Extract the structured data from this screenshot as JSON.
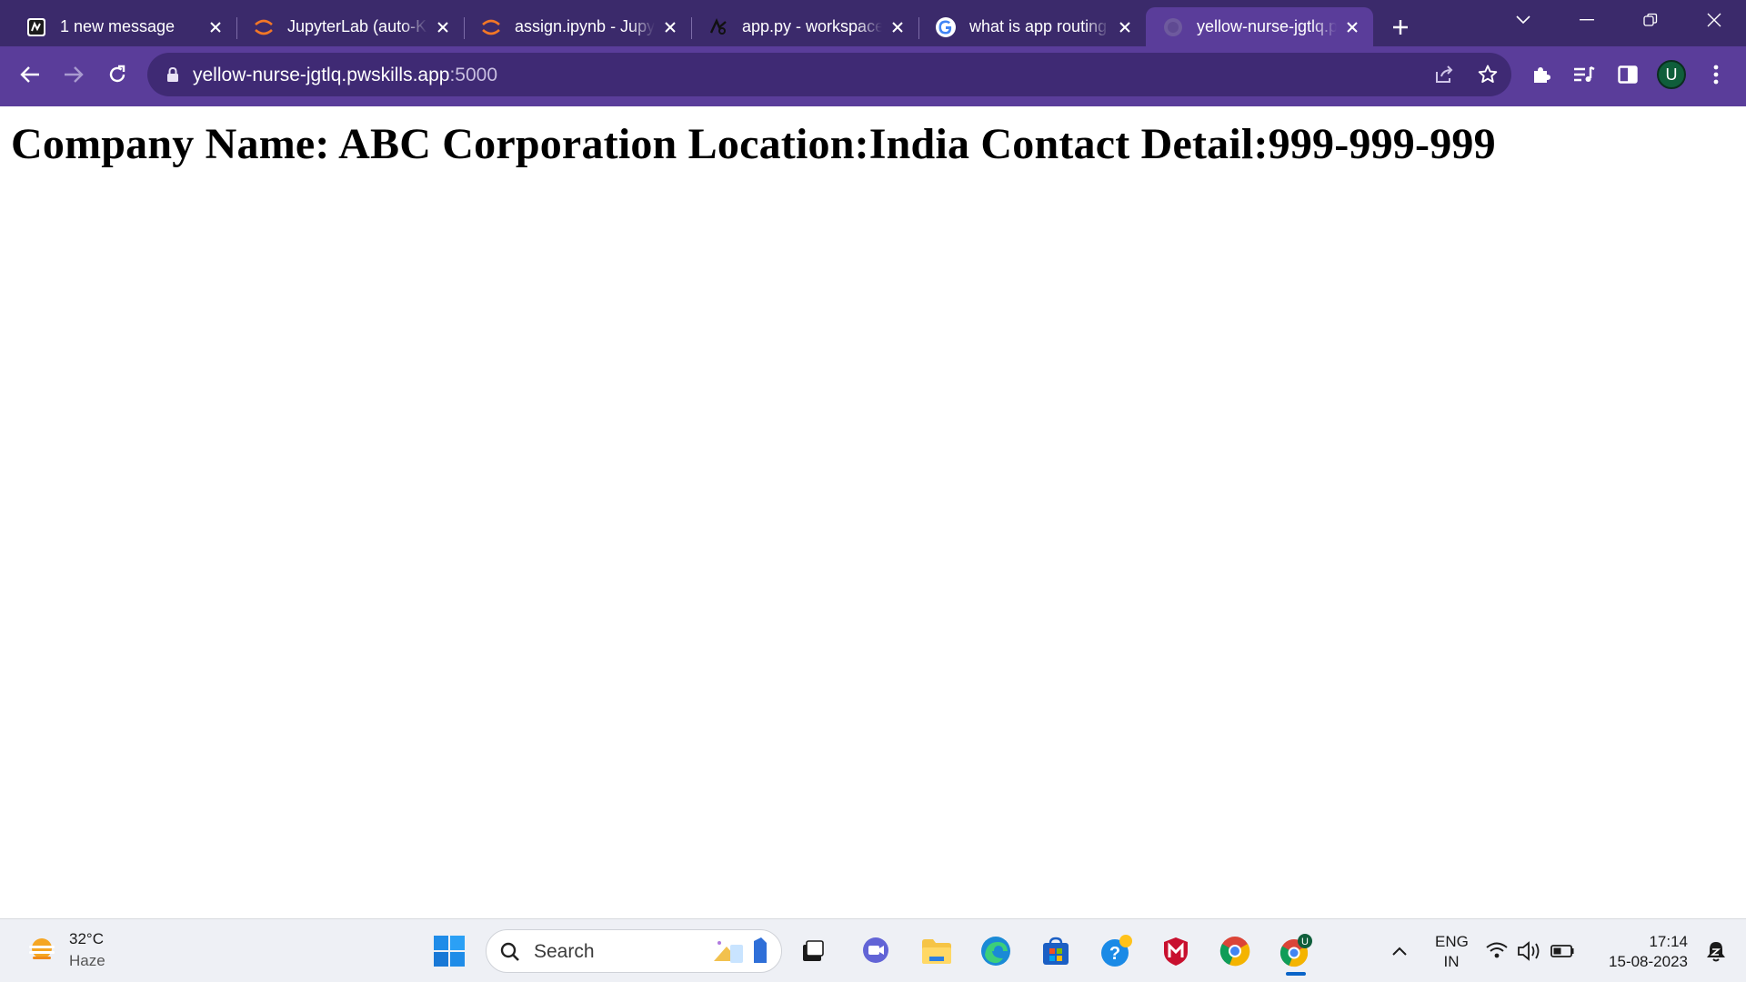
{
  "browser": {
    "tabs": [
      {
        "title": "1 new message",
        "favicon": "pw-skills-icon",
        "active": false
      },
      {
        "title": "JupyterLab (auto-K)",
        "favicon": "jupyter-icon",
        "active": false
      },
      {
        "title": "assign.ipynb - JupyterLab",
        "favicon": "jupyter-icon",
        "active": false
      },
      {
        "title": "app.py - workspace",
        "favicon": "code-icon",
        "active": false
      },
      {
        "title": "what is app routing",
        "favicon": "google-icon",
        "active": false
      },
      {
        "title": "yellow-nurse-jgtlq.pwskills.app",
        "favicon": "globe-icon",
        "active": true
      }
    ],
    "address": {
      "host": "yellow-nurse-jgtlq.pwskills.app",
      "port": ":5000"
    },
    "profile_initial": "U"
  },
  "page": {
    "heading": "Company Name: ABC Corporation Location:India Contact Detail:999-999-999"
  },
  "taskbar": {
    "weather": {
      "temp": "32°C",
      "condition": "Haze"
    },
    "search_placeholder": "Search",
    "language": {
      "line1": "ENG",
      "line2": "IN"
    },
    "clock": {
      "time": "17:14",
      "date": "15-08-2023"
    }
  },
  "colors": {
    "tabstrip": "#3b2a6b",
    "toolbar": "#5a3d9a",
    "omnibox": "#3f2a74"
  }
}
